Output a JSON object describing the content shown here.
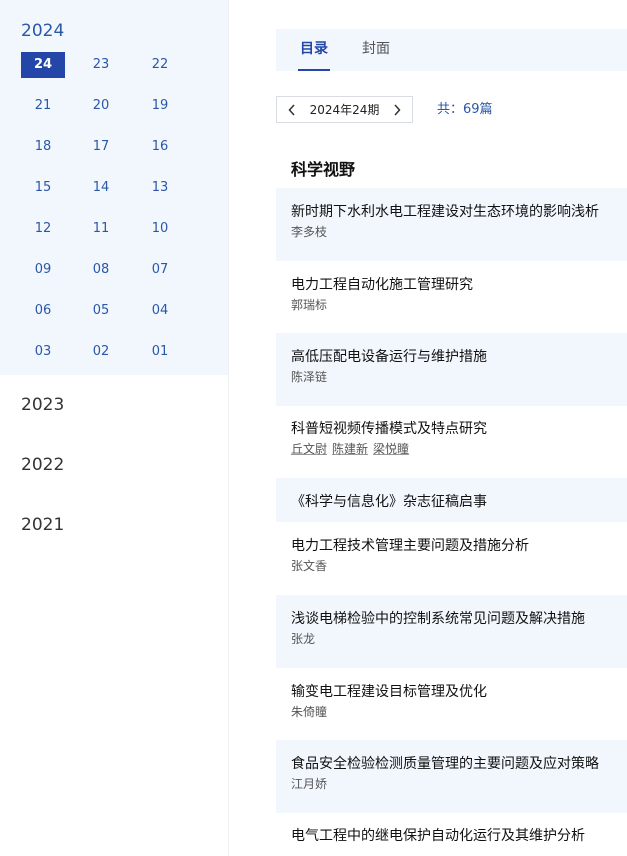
{
  "sidebar": {
    "open_year": "2024",
    "issues": [
      "24",
      "23",
      "22",
      "21",
      "20",
      "19",
      "18",
      "17",
      "16",
      "15",
      "14",
      "13",
      "12",
      "11",
      "10",
      "09",
      "08",
      "07",
      "06",
      "05",
      "04",
      "03",
      "02",
      "01"
    ],
    "active_issue": "24",
    "other_years": [
      "2023",
      "2022",
      "2021"
    ]
  },
  "tabs": {
    "toc": "目录",
    "cover": "封面"
  },
  "picker": {
    "label": "2024年24期"
  },
  "count": "共：69篇",
  "section": "科学视野",
  "articles": [
    {
      "title": "新时期下水利水电工程建设对生态环境的影响浅析",
      "authors": [
        "李多枝"
      ]
    },
    {
      "title": "电力工程自动化施工管理研究",
      "authors": [
        "郭瑞标"
      ]
    },
    {
      "title": "高低压配电设备运行与维护措施",
      "authors": [
        "陈泽链"
      ]
    },
    {
      "title": "科普短视频传播模式及特点研究",
      "authors": [
        "丘文尉",
        "陈建新",
        "梁悦瞳"
      ]
    },
    {
      "title": "《科学与信息化》杂志征稿启事",
      "authors": []
    },
    {
      "title": "电力工程技术管理主要问题及措施分析",
      "authors": [
        "张文香"
      ]
    },
    {
      "title": "浅谈电梯检验中的控制系统常见问题及解决措施",
      "authors": [
        "张龙"
      ]
    },
    {
      "title": "输变电工程建设目标管理及优化",
      "authors": [
        "朱倚瞳"
      ]
    },
    {
      "title": "食品安全检验检测质量管理的主要问题及应对策略",
      "authors": [
        "江月娇"
      ]
    },
    {
      "title": "电气工程中的继电保护自动化运行及其维护分析",
      "authors": []
    }
  ],
  "colors": {
    "accent": "#2346a8",
    "link": "#2a57a8",
    "shade": "#f2f7fe"
  }
}
